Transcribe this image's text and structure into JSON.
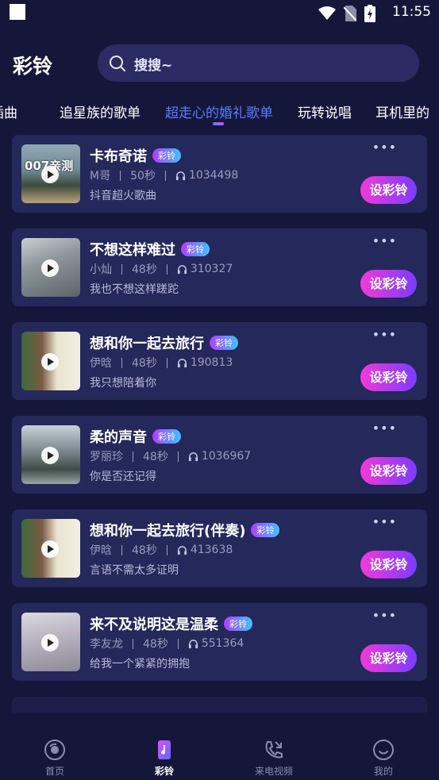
{
  "status_bar": {
    "time": "11:55"
  },
  "header": {
    "title": "彩铃",
    "search_placeholder": "搜搜~"
  },
  "tabs": [
    {
      "label": "插曲"
    },
    {
      "label": "追星族的歌单"
    },
    {
      "label": "超走心的婚礼歌单",
      "active": true
    },
    {
      "label": "玩转说唱"
    },
    {
      "label": "耳机里的"
    }
  ],
  "badge_label": "彩铃",
  "set_label": "设彩铃",
  "more_label": "•••",
  "songs": [
    {
      "title": "卡布奇诺",
      "artist": "M哥",
      "duration": "50秒",
      "plays": "1034498",
      "desc": "抖音超火歌曲",
      "thumb_text": "007亲测"
    },
    {
      "title": "不想这样难过",
      "artist": "小灿",
      "duration": "48秒",
      "plays": "310327",
      "desc": "我也不想这样蹉跎",
      "thumb_text": ""
    },
    {
      "title": "想和你一起去旅行",
      "artist": "伊晗",
      "duration": "48秒",
      "plays": "190813",
      "desc": "我只想陪着你",
      "thumb_text": ""
    },
    {
      "title": "柔的声音",
      "artist": "罗丽珍",
      "duration": "48秒",
      "plays": "1036967",
      "desc": "你是否还记得",
      "thumb_text": ""
    },
    {
      "title": "想和你一起去旅行(伴奏)",
      "artist": "伊晗",
      "duration": "48秒",
      "plays": "413638",
      "desc": "言语不需太多证明",
      "thumb_text": ""
    },
    {
      "title": "来不及说明这是温柔",
      "artist": "李友龙",
      "duration": "48秒",
      "plays": "551364",
      "desc": "给我一个紧紧的拥抱",
      "thumb_text": ""
    }
  ],
  "bottom_nav": [
    {
      "label": "首页",
      "icon": "disc-icon"
    },
    {
      "label": "彩铃",
      "icon": "ringtone-icon",
      "active": true
    },
    {
      "label": "来电视频",
      "icon": "call-video-icon"
    },
    {
      "label": "我的",
      "icon": "profile-icon"
    }
  ]
}
